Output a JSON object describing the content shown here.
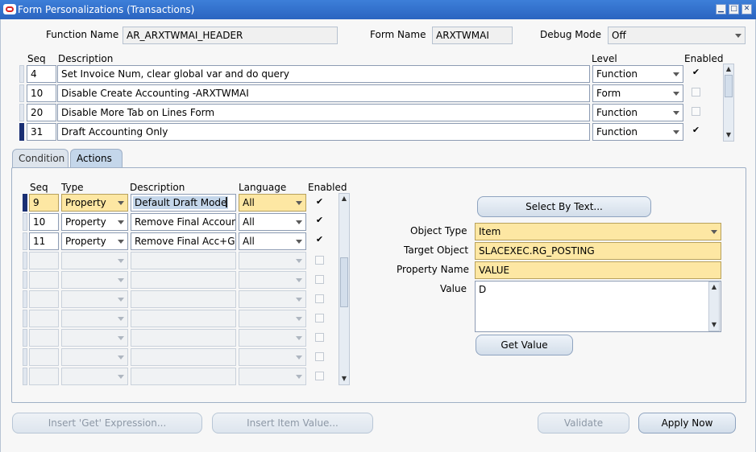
{
  "window": {
    "title": "Form Personalizations (Transactions)",
    "min": "▁",
    "max": "□",
    "close": "✕"
  },
  "header": {
    "function_name_label": "Function Name",
    "function_name_value": "AR_ARXTWMAI_HEADER",
    "form_name_label": "Form Name",
    "form_name_value": "ARXTWMAI",
    "debug_mode_label": "Debug Mode",
    "debug_mode_value": "Off"
  },
  "rules": {
    "headers": {
      "seq": "Seq",
      "description": "Description",
      "level": "Level",
      "enabled": "Enabled"
    },
    "rows": [
      {
        "seq": "4",
        "description": "Set Invoice Num, clear global var and do query",
        "level": "Function",
        "enabled": "✔"
      },
      {
        "seq": "10",
        "description": "Disable Create Accounting -ARXTWMAI",
        "level": "Form",
        "enabled": ""
      },
      {
        "seq": "20",
        "description": "Disable More Tab on Lines Form",
        "level": "Function",
        "enabled": ""
      },
      {
        "seq": "31",
        "description": "Draft Accounting Only",
        "level": "Function",
        "enabled": "✔"
      }
    ]
  },
  "tabs": {
    "condition": "Condition",
    "actions": "Actions"
  },
  "actions": {
    "headers": {
      "seq": "Seq",
      "type": "Type",
      "description": "Description",
      "language": "Language",
      "enabled": "Enabled"
    },
    "rows": [
      {
        "seq": "9",
        "type": "Property",
        "description": "Default Draft Mode",
        "language": "All",
        "enabled": "✔"
      },
      {
        "seq": "10",
        "type": "Property",
        "description": "Remove Final Account",
        "language": "All",
        "enabled": "✔"
      },
      {
        "seq": "11",
        "type": "Property",
        "description": "Remove Final Acc+GL",
        "language": "All",
        "enabled": "✔"
      }
    ]
  },
  "details": {
    "select_by_text": "Select By Text...",
    "object_type_label": "Object Type",
    "object_type_value": "Item",
    "target_object_label": "Target Object",
    "target_object_value": "SLACEXEC.RG_POSTING",
    "property_name_label": "Property Name",
    "property_name_value": "VALUE",
    "value_label": "Value",
    "value_value": "D",
    "get_value": "Get Value"
  },
  "footer": {
    "insert_get_expression": "Insert 'Get' Expression...",
    "insert_item_value": "Insert Item Value...",
    "validate": "Validate",
    "apply_now": "Apply Now"
  },
  "colors": {
    "titlebar": "#2a64c0",
    "required_field": "#fde7a3",
    "active_tab": "#c4d6ea",
    "current_row": "#1a2f73"
  }
}
